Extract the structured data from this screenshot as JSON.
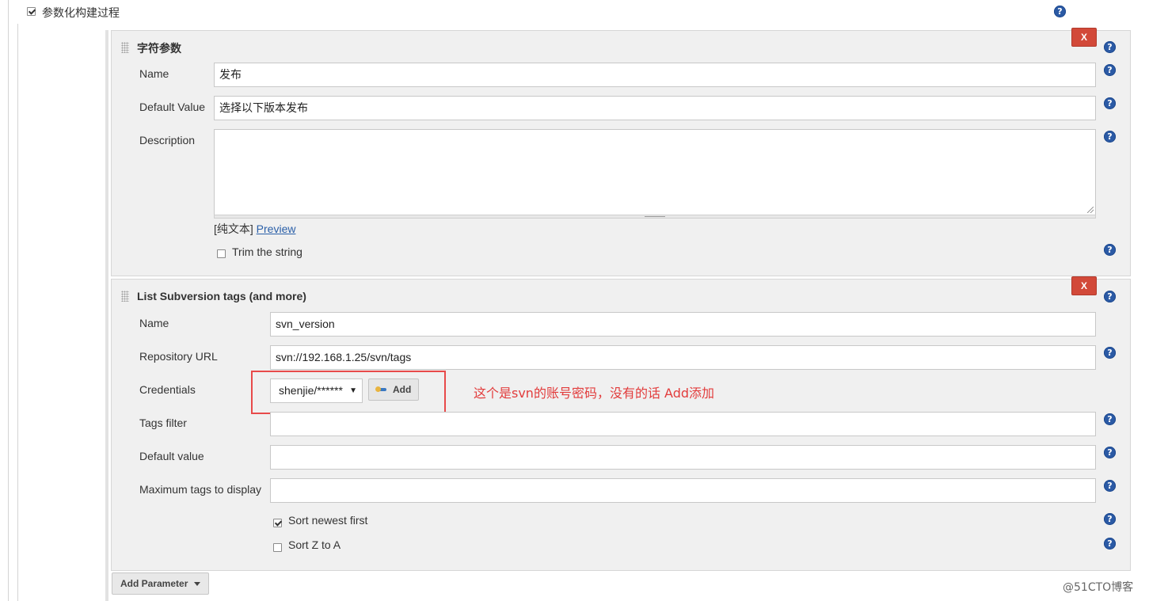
{
  "header": {
    "checkbox_label": "参数化构建过程",
    "checked": true
  },
  "string_param": {
    "title": "字符参数",
    "delete_label": "X",
    "name_label": "Name",
    "name_value": "发布",
    "default_label": "Default Value",
    "default_value": "选择以下版本发布",
    "description_label": "Description",
    "description_value": "",
    "plain_text_label": "[纯文本]",
    "preview_label": "Preview",
    "trim_label": "Trim the string",
    "trim_checked": false
  },
  "svn_param": {
    "title": "List Subversion tags (and more)",
    "delete_label": "X",
    "name_label": "Name",
    "name_value": "svn_version",
    "repo_label": "Repository URL",
    "repo_value": "svn://192.168.1.25/svn/tags",
    "credentials_label": "Credentials",
    "credentials_value": "shenjie/******",
    "add_label": "Add",
    "tags_filter_label": "Tags filter",
    "tags_filter_value": "",
    "default_value_label": "Default value",
    "default_value_value": "",
    "max_tags_label": "Maximum tags to display",
    "max_tags_value": "",
    "sort_newest_label": "Sort newest first",
    "sort_newest_checked": true,
    "sort_za_label": "Sort Z to A",
    "sort_za_checked": false
  },
  "annotation": {
    "note": "这个是svn的账号密码，没有的话 Add添加",
    "color": "#e23c3c"
  },
  "footer": {
    "add_parameter_label": "Add Parameter"
  },
  "watermark": "@51CTO博客",
  "colors": {
    "delete_red": "#d24939",
    "help_blue": "#2b5aa5",
    "panel_bg": "#f0f0f0"
  }
}
